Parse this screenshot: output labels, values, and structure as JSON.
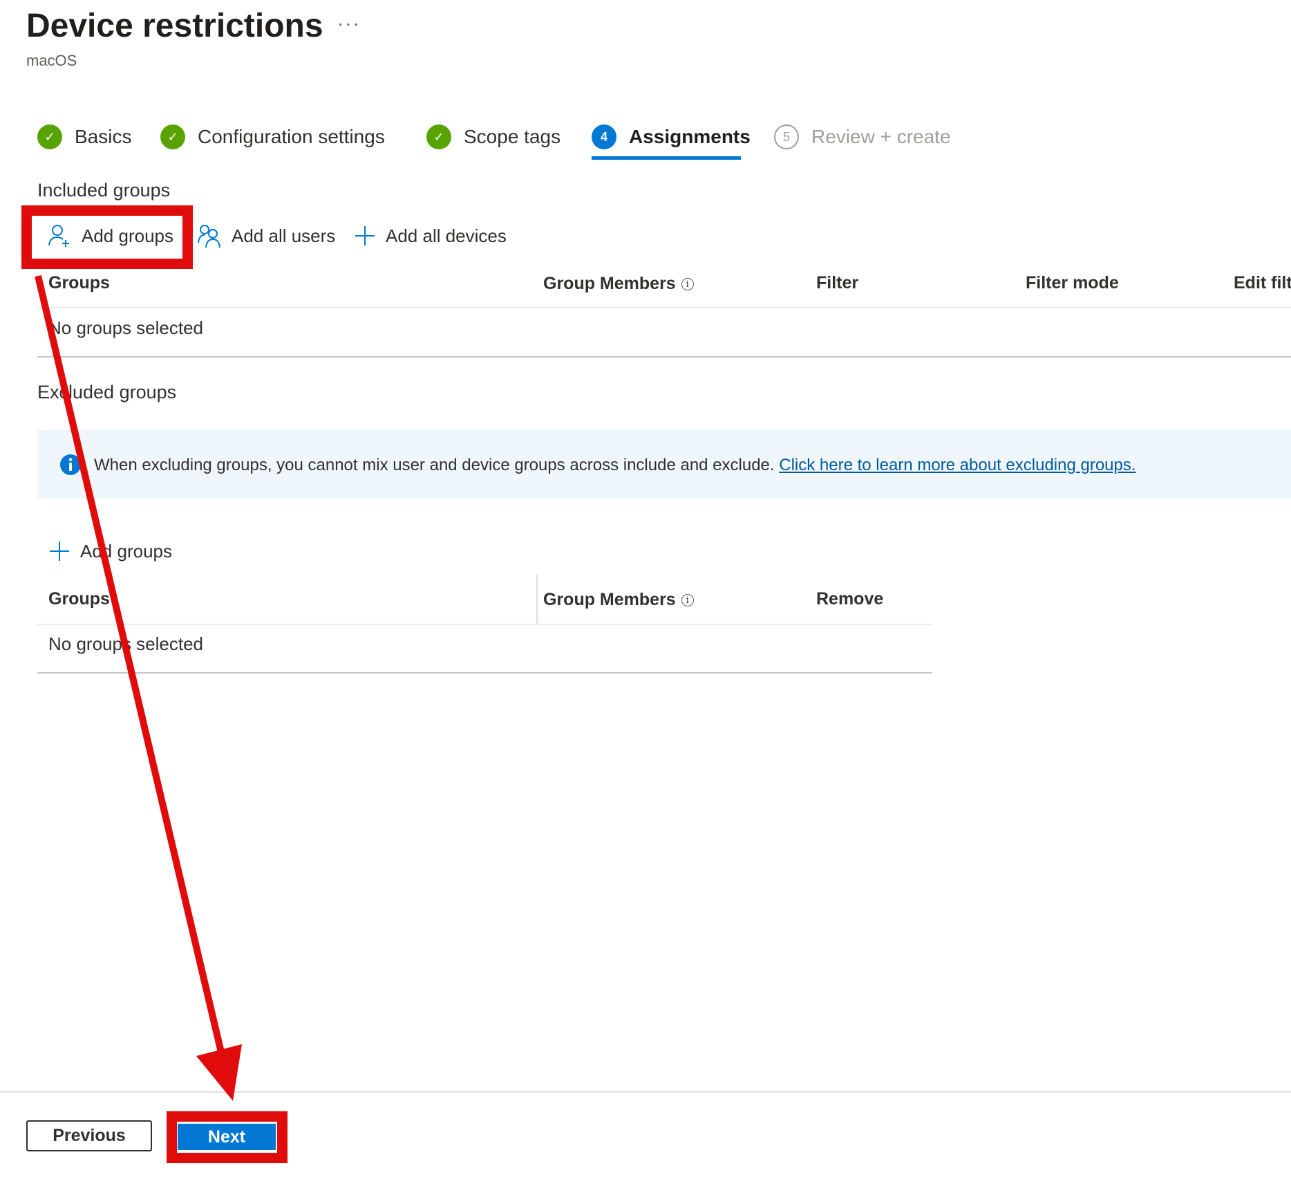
{
  "header": {
    "title": "Device restrictions",
    "more_label": "···",
    "subtitle": "macOS"
  },
  "steps": [
    {
      "label": "Basics",
      "state": "done",
      "icon": "checkmark-icon"
    },
    {
      "label": "Configuration settings",
      "state": "done",
      "icon": "checkmark-icon"
    },
    {
      "label": "Scope tags",
      "state": "done",
      "icon": "checkmark-icon"
    },
    {
      "label": "Assignments",
      "state": "current",
      "number": "4"
    },
    {
      "label": "Review + create",
      "state": "pending",
      "number": "5"
    }
  ],
  "included": {
    "title": "Included groups",
    "toolbar": {
      "add_groups": "Add groups",
      "add_all_users": "Add all users",
      "add_all_devices": "Add all devices"
    },
    "columns": [
      "Groups",
      "Group Members",
      "Filter",
      "Filter mode",
      "Edit filt"
    ],
    "empty": "No groups selected"
  },
  "excluded": {
    "title": "Excluded groups",
    "info_text": "When excluding groups, you cannot mix user and device groups across include and exclude.",
    "info_link": "Click here to learn more about excluding groups.",
    "add_groups": "Add groups",
    "columns": [
      "Groups",
      "Group Members",
      "Remove"
    ],
    "empty": "No groups selected"
  },
  "footer": {
    "previous": "Previous",
    "next": "Next"
  },
  "colors": {
    "accent": "#0078d4",
    "success": "#57a300",
    "annotation": "#e00b0b",
    "info_bg": "#eff6fc"
  }
}
